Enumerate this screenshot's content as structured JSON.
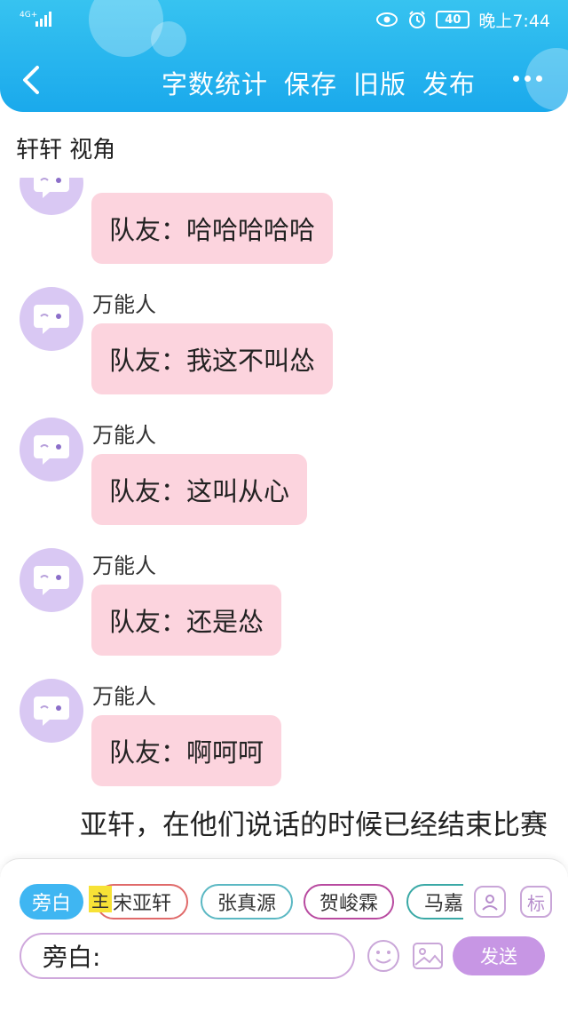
{
  "status_bar": {
    "network": "4G⁺",
    "battery": "40",
    "time": "晚上7:44"
  },
  "nav": {
    "word_count": "字数统计",
    "save": "保存",
    "old_version": "旧版",
    "publish": "发布"
  },
  "perspective_title": "轩轩 视角",
  "messages": [
    {
      "sender": "",
      "text": "队友：哈哈哈哈哈"
    },
    {
      "sender": "万能人",
      "text": "队友：我这不叫怂"
    },
    {
      "sender": "万能人",
      "text": "队友：这叫从心"
    },
    {
      "sender": "万能人",
      "text": "队友：还是怂"
    },
    {
      "sender": "万能人",
      "text": "队友：啊呵呵"
    }
  ],
  "narration": "亚轩，在他们说话的时候已经结束比赛",
  "roles": {
    "active": "旁白",
    "main_badge": "主",
    "items": [
      "宋亚轩",
      "张真源",
      "贺峻霖",
      "马嘉"
    ]
  },
  "side_icons": {
    "person": "person-icon",
    "tag": "标"
  },
  "input": {
    "value": "旁白:"
  },
  "send_label": "发送",
  "colors": {
    "header": "#1aa9ec",
    "bubble": "#fcd4de",
    "avatar": "#d9c8f3",
    "send": "#c796e4"
  }
}
